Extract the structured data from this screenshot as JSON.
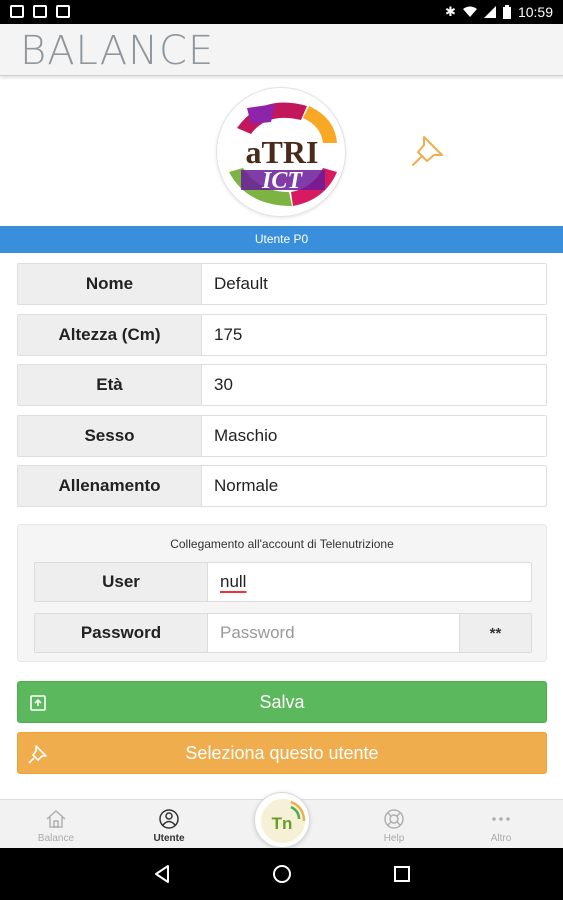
{
  "status_bar": {
    "left_icons": [
      "image-icon",
      "clipboard-check-icon",
      "gallery-icon"
    ],
    "right_icons": [
      "bluetooth-icon",
      "wifi-icon",
      "signal-icon",
      "battery-icon"
    ],
    "time": "10:59"
  },
  "app_bar": {
    "title": "BALANCE"
  },
  "logo": {
    "alt": "ATRI ICT"
  },
  "user_header": "Utente P0",
  "profile": [
    {
      "label": "Nome",
      "value": "Default"
    },
    {
      "label": "Altezza (Cm)",
      "value": "175"
    },
    {
      "label": "Età",
      "value": "30"
    },
    {
      "label": "Sesso",
      "value": "Maschio"
    },
    {
      "label": "Allenamento",
      "value": "Normale"
    }
  ],
  "account": {
    "title": "Collegamento all'account di Telenutrizione",
    "user_label": "User",
    "user_value": "null",
    "password_label": "Password",
    "password_placeholder": "Password",
    "password_toggle": "**"
  },
  "actions": {
    "save_label": "Salva",
    "select_label": "Seleziona questo utente"
  },
  "tabs": [
    {
      "label": "Balance",
      "icon": "home-icon",
      "active": false
    },
    {
      "label": "Utente",
      "icon": "user-icon",
      "active": true
    },
    {
      "label": "Help",
      "icon": "lifebuoy-icon",
      "active": false
    },
    {
      "label": "Altro",
      "icon": "more-icon",
      "active": false
    }
  ],
  "center_button": {
    "label": "Tn"
  },
  "colors": {
    "accent_blue": "#3a8fdc",
    "save_green": "#5cb85c",
    "select_orange": "#f0ad4e",
    "pin_orange": "#f0ad4e"
  }
}
